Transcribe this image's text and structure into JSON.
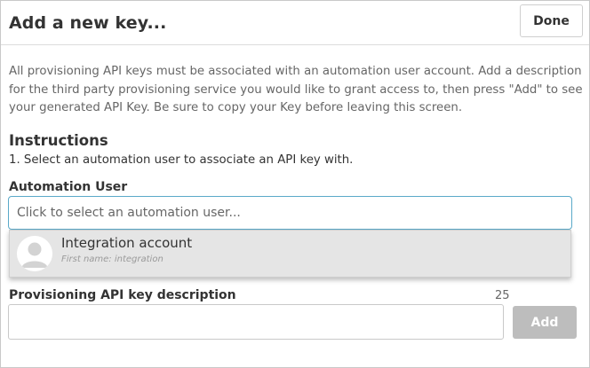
{
  "dialog": {
    "title": "Add a new key...",
    "done_label": "Done"
  },
  "description": "All provisioning API keys must be associated with an automation user account. Add a description for the third party provisioning service you would like to grant access to, then press \"Add\" to see your generated API Key. Be sure to copy your Key before leaving this screen.",
  "instructions": {
    "heading": "Instructions",
    "step": "1. Select an automation user to associate an API key with."
  },
  "automation_user": {
    "label": "Automation User",
    "placeholder": "Click to select an automation user...",
    "options": [
      {
        "name": "Integration account",
        "subtitle": "First name: integration",
        "avatar_icon": "user-avatar-icon"
      }
    ]
  },
  "api_key_description": {
    "label": "Provisioning API key description",
    "char_count": "25",
    "value": "",
    "add_label": "Add"
  },
  "colors": {
    "focus_border": "#5aa9c9",
    "dropdown_bg": "#e5e5e5",
    "add_button_disabled": "#bdbdbd"
  }
}
